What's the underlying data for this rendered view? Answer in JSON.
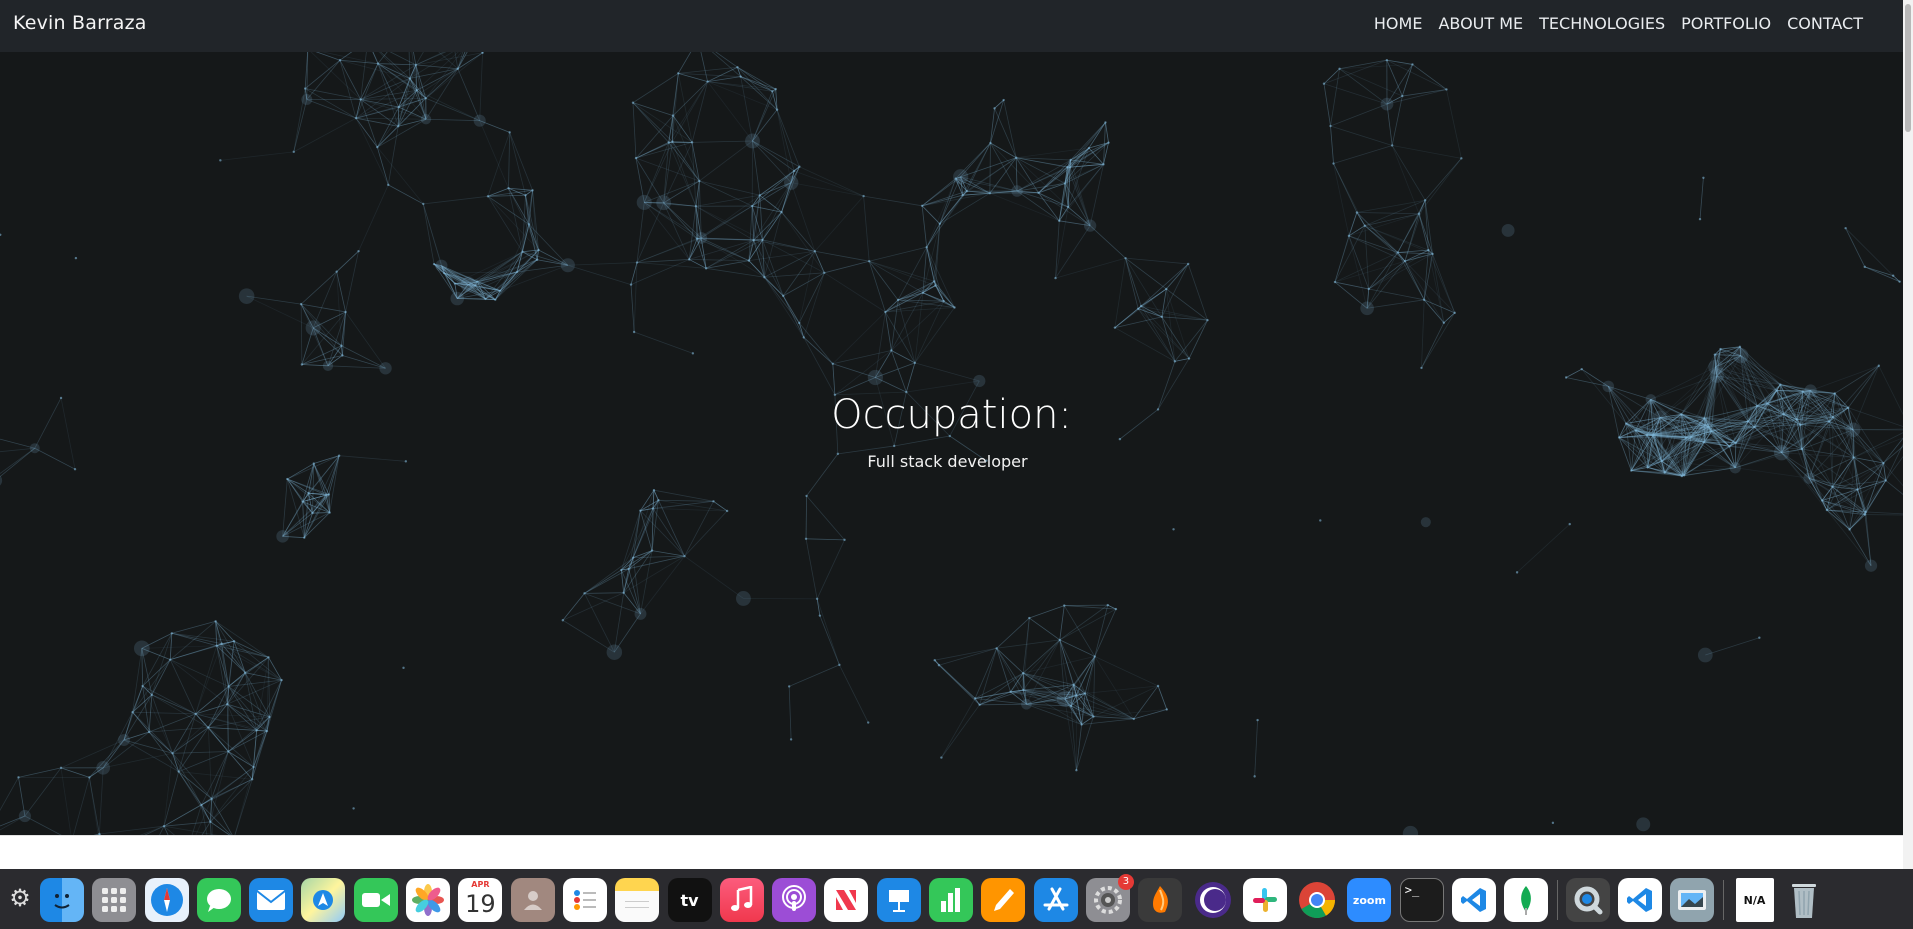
{
  "navbar": {
    "brand": "Kevin Barraza",
    "links": [
      {
        "label": "HOME"
      },
      {
        "label": "ABOUT ME"
      },
      {
        "label": "TECHNOLOGIES"
      },
      {
        "label": "PORTFOLIO"
      },
      {
        "label": "CONTACT"
      }
    ]
  },
  "hero": {
    "title": "Occupation:",
    "subtitle": "Full stack developer"
  },
  "colors": {
    "navbar_bg": "#212529",
    "hero_bg": "#151819",
    "particle_line": "#7fb4d4",
    "dock_bg": "#2b2b2f"
  },
  "dock": {
    "calendar": {
      "month": "APR",
      "day": "19"
    },
    "appletv_label": "tv",
    "zoom_label": "zoom",
    "terminal_label": ">_",
    "settings_badge": "3",
    "na_label": "N/A",
    "apps": [
      "finder-icon",
      "launchpad-icon",
      "safari-icon",
      "messages-icon",
      "mail-icon",
      "maps-icon",
      "facetime-icon",
      "photos-icon",
      "calendar-icon",
      "contacts-icon",
      "reminders-icon",
      "notes-icon",
      "appletv-icon",
      "music-icon",
      "podcasts-icon",
      "news-icon",
      "keynote-icon",
      "numbers-icon",
      "pages-icon",
      "appstore-icon",
      "system-settings-icon",
      "fl-studio-icon",
      "tor-browser-icon",
      "slack-icon",
      "chrome-icon",
      "zoom-icon",
      "terminal-icon",
      "vscode-icon",
      "mongodb-icon",
      "quicktime-icon",
      "vscode-insiders-icon",
      "preview-icon",
      "na-document-icon",
      "trash-icon"
    ]
  }
}
